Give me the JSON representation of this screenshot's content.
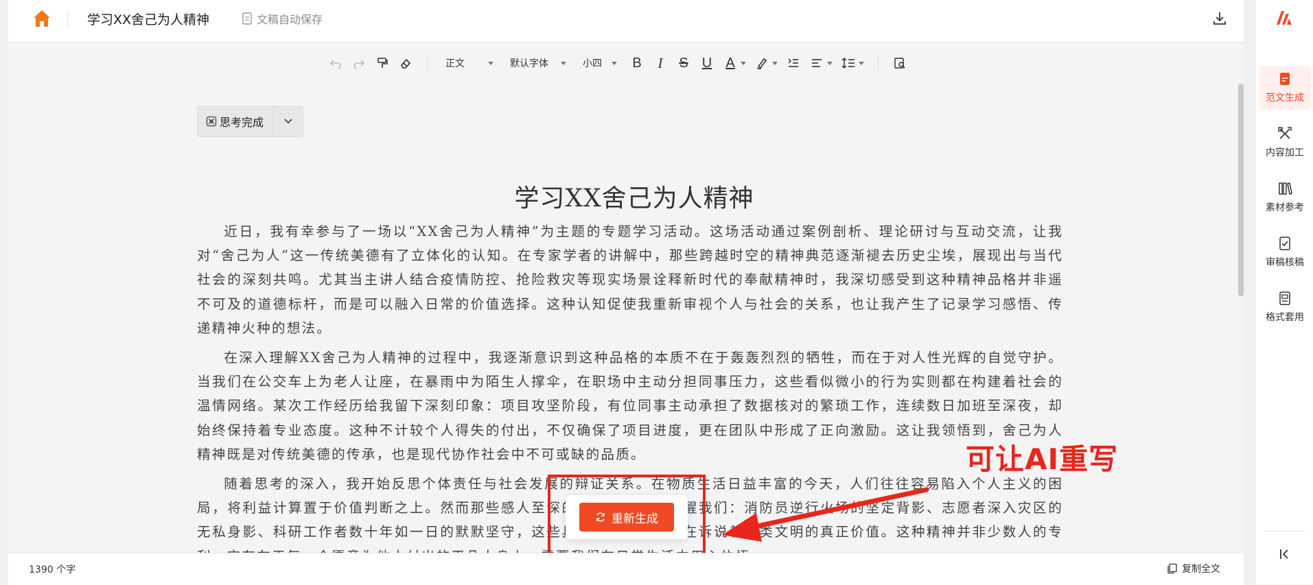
{
  "header": {
    "doc_title": "学习XX舍己为人精神",
    "autosave_label": "文稿自动保存"
  },
  "toolbar": {
    "paragraph_style": "正文",
    "font_family": "默认字体",
    "font_size": "小四",
    "bold": "B",
    "italic": "I",
    "strike": "S",
    "underline": "U",
    "font_color": "A"
  },
  "thinking": {
    "label": "思考完成"
  },
  "article": {
    "title": "学习XX舍己为人精神",
    "paragraphs": [
      "近日，我有幸参与了一场以“XX舍己为人精神”为主题的专题学习活动。这场活动通过案例剖析、理论研讨与互动交流，让我对“舍己为人”这一传统美德有了立体化的认知。在专家学者的讲解中，那些跨越时空的精神典范逐渐褪去历史尘埃，展现出与当代社会的深刻共鸣。尤其当主讲人结合疫情防控、抢险救灾等现实场景诠释新时代的奉献精神时，我深切感受到这种精神品格并非遥不可及的道德标杆，而是可以融入日常的价值选择。这种认知促使我重新审视个人与社会的关系，也让我产生了记录学习感悟、传递精神火种的想法。",
      "在深入理解XX舍己为人精神的过程中，我逐渐意识到这种品格的本质不在于轰轰烈烈的牺牲，而在于对人性光辉的自觉守护。当我们在公交车上为老人让座，在暴雨中为陌生人撑伞，在职场中主动分担同事压力，这些看似微小的行为实则都在构建着社会的温情网络。某次工作经历给我留下深刻印象：项目攻坚阶段，有位同事主动承担了数据核对的繁琐工作，连续数日加班至深夜，却始终保持着专业态度。这种不计较个人得失的付出，不仅确保了项目进度，更在团队中形成了正向激励。这让我领悟到，舍己为人精神既是对传统美德的传承，也是现代协作社会中不可或缺的品质。",
      "随着思考的深入，我开始反思个体责任与社会发展的辩证关系。在物质生活日益丰富的今天，人们往往容易陷入个人主义的困局，将利益计算置于价值判断之上。然而那些感人至深的社会事件总在提醒我们：消防员逆行火场的坚定背影、志愿者深入灾区的无私身影、科研工作者数十年如一日的默默坚守，这些具体而微的奉献都在诉说着人类文明的真正价值。这种精神并非少数人的专利，它存在于每一个愿意为他人付出的平凡人身上，需要我们在日常生活中用心体悟。"
    ]
  },
  "regenerate": {
    "label": "重新生成"
  },
  "annotation": {
    "text": "可让AI重写",
    "color": "#e8261b"
  },
  "status": {
    "word_count": "1390 个字",
    "copy_all": "复制全文"
  },
  "sidebar": {
    "items": [
      {
        "label": "范文生成",
        "icon": "document-icon",
        "active": true
      },
      {
        "label": "内容加工",
        "icon": "tools-icon",
        "active": false
      },
      {
        "label": "素材参考",
        "icon": "books-icon",
        "active": false
      },
      {
        "label": "审稿核稿",
        "icon": "checklist-icon",
        "active": false
      },
      {
        "label": "格式套用",
        "icon": "format-icon",
        "active": false
      }
    ]
  },
  "colors": {
    "accent": "#ef4a23",
    "brand_orange": "#f07a1a"
  }
}
